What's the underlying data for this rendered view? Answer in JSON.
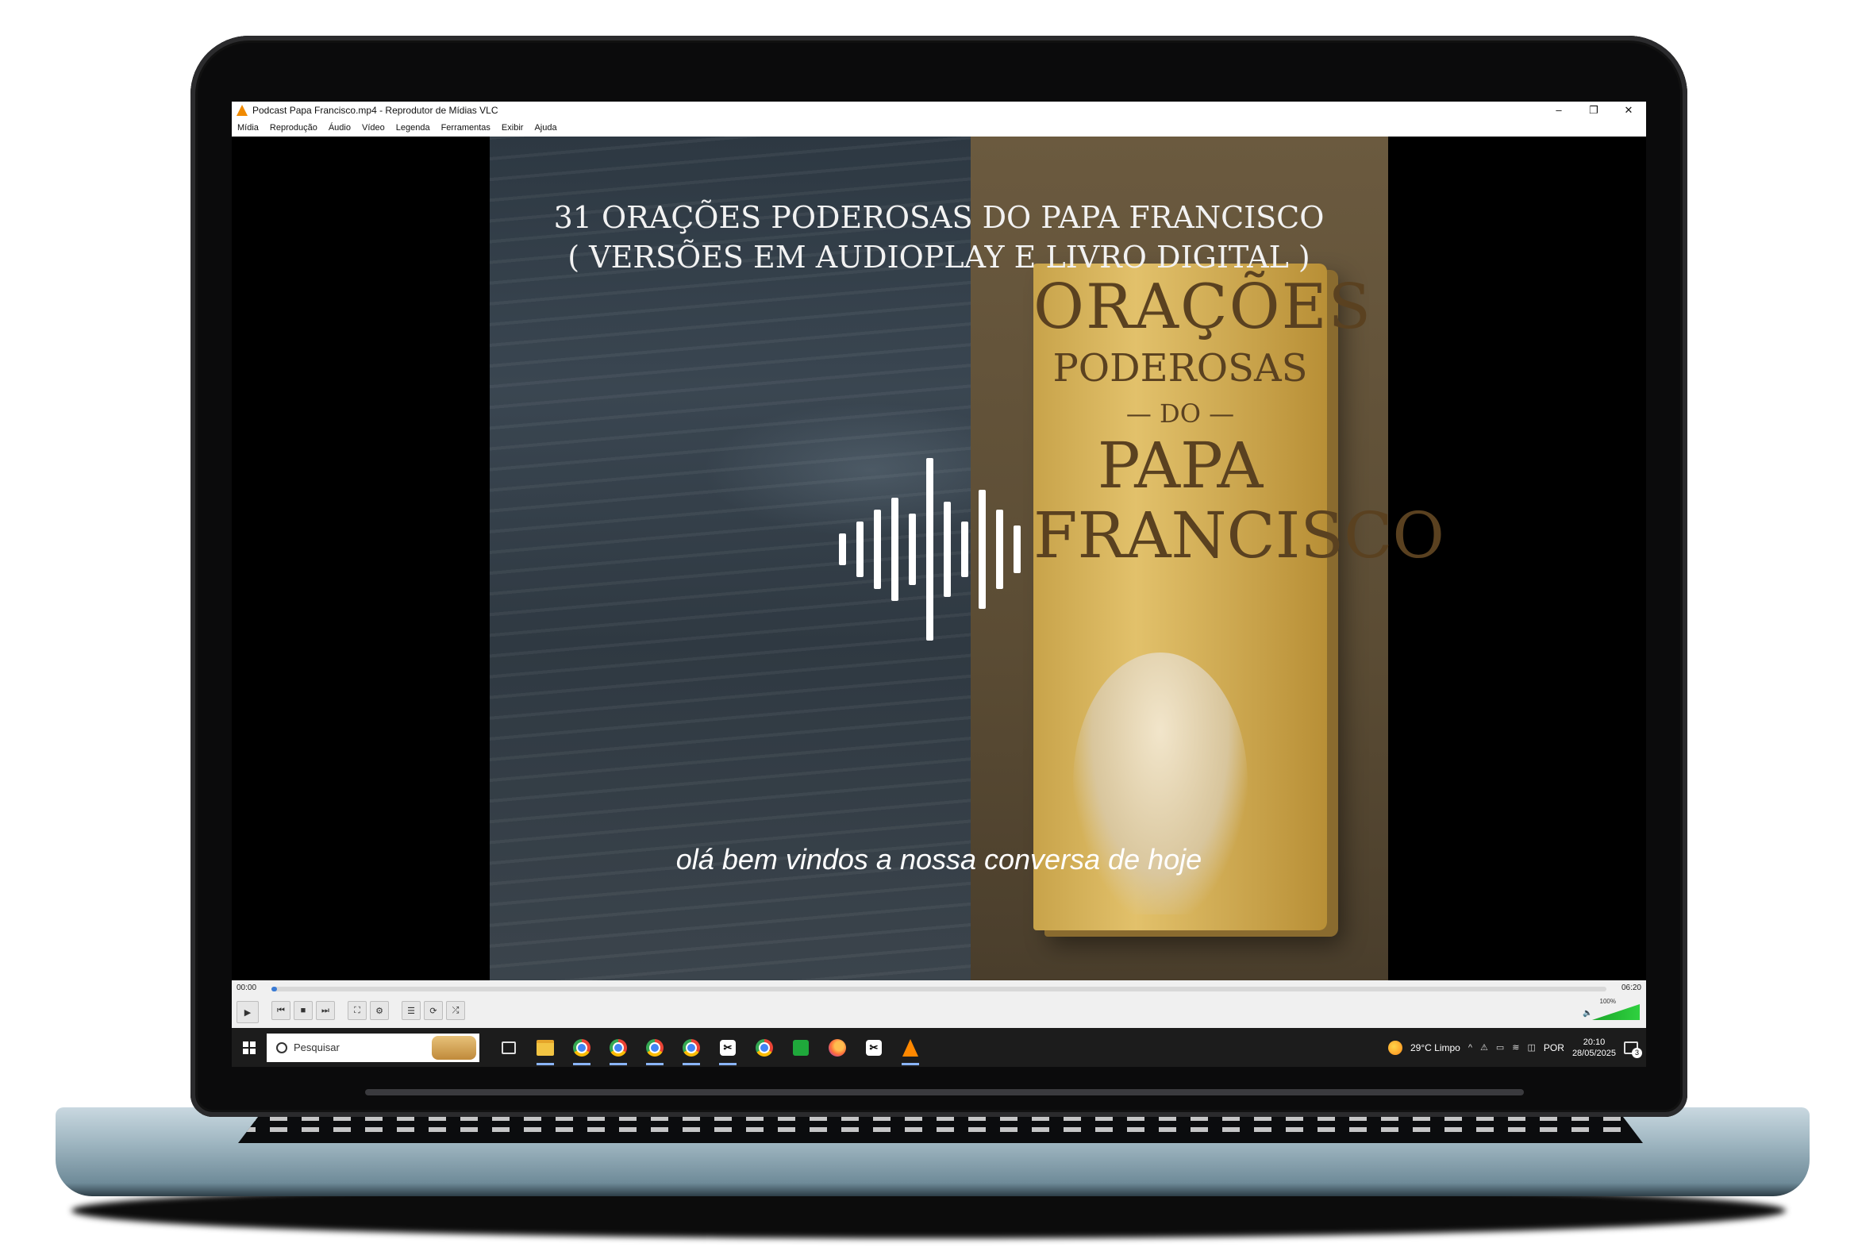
{
  "window": {
    "title": "Podcast Papa Francisco.mp4 - Reprodutor de Mídias VLC",
    "controls": [
      "–",
      "❐",
      "✕"
    ]
  },
  "menu": [
    "Mídia",
    "Reprodução",
    "Áudio",
    "Vídeo",
    "Legenda",
    "Ferramentas",
    "Exibir",
    "Ajuda"
  ],
  "video": {
    "title_line1": "31 ORAÇÕES PODEROSAS DO PAPA FRANCISCO",
    "title_line2": "( VERSÕES EM AUDIOPLAY E LIVRO DIGITAL )",
    "book_line1": "ORAÇÕES",
    "book_line2": "PODEROSAS",
    "book_line3": "— DO —",
    "book_line4": "PAPA",
    "book_line5": "FRANCISCO",
    "subtitle": "olá bem vindos a nossa conversa de hoje"
  },
  "player": {
    "time_elapsed": "00:00",
    "time_total": "06:20",
    "progress_fraction": 0.002,
    "volume_label": "100%",
    "volume_fraction": 1.0,
    "buttons": {
      "play": "▶",
      "prev": "⏮",
      "stop": "■",
      "next": "⏭",
      "fullscreen": "⛶",
      "extended": "⚙",
      "playlist": "☰",
      "loop": "⟳",
      "random": "⤮"
    }
  },
  "taskbar": {
    "search_placeholder": "Pesquisar",
    "weather": "29°C  Limpo",
    "language": "POR",
    "time": "20:10",
    "date": "28/05/2025",
    "notification_count": "3",
    "tray_icons": [
      "^",
      "⚠",
      "▭",
      "≋",
      "◫"
    ],
    "app_icons": [
      "task-view-icon",
      "file-explorer-icon",
      "chrome-icon",
      "chrome-icon",
      "chrome-icon",
      "chrome-icon",
      "capcut-icon",
      "chrome-icon",
      "green-app-icon",
      "firefox-icon",
      "capcut-icon",
      "vlc-icon"
    ]
  },
  "colors": {
    "accent": "#3a7bd5",
    "vlc_orange": "#f08a00",
    "volume_green": "#2fd13f"
  }
}
